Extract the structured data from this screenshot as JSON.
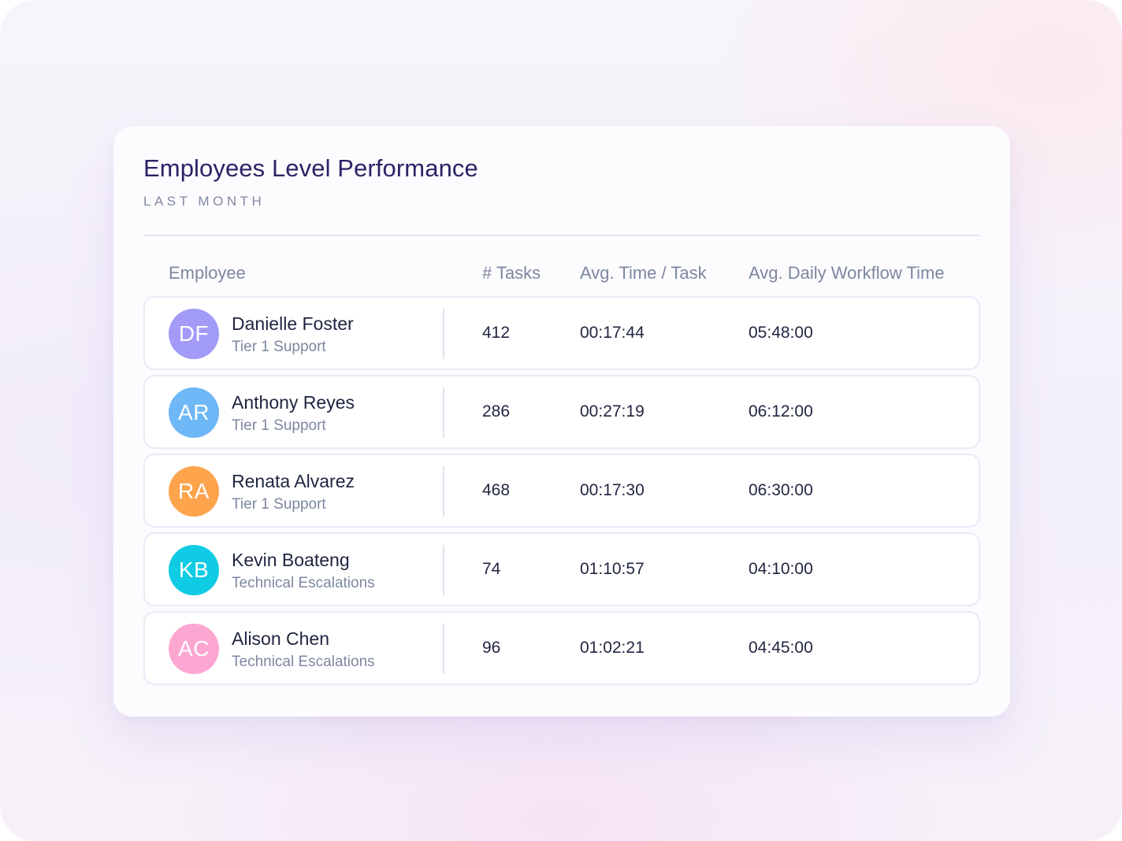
{
  "card": {
    "title": "Employees Level Performance",
    "subtitle": "LAST MONTH"
  },
  "table": {
    "columns": [
      "Employee",
      "# Tasks",
      "Avg. Time / Task",
      "Avg. Daily Workflow Time"
    ],
    "rows": [
      {
        "initials": "DF",
        "name": "Danielle Foster",
        "team": "Tier 1 Support",
        "tasks": "412",
        "avg_time": "00:17:44",
        "daily_time": "05:48:00",
        "avatar_color": "#a29bf8"
      },
      {
        "initials": "AR",
        "name": "Anthony Reyes",
        "team": "Tier 1 Support",
        "tasks": "286",
        "avg_time": "00:27:19",
        "daily_time": "06:12:00",
        "avatar_color": "#6fb8f7"
      },
      {
        "initials": "RA",
        "name": "Renata Alvarez",
        "team": "Tier 1 Support",
        "tasks": "468",
        "avg_time": "00:17:30",
        "daily_time": "06:30:00",
        "avatar_color": "#fda44c"
      },
      {
        "initials": "KB",
        "name": "Kevin Boateng",
        "team": "Technical Escalations",
        "tasks": "74",
        "avg_time": "01:10:57",
        "daily_time": "04:10:00",
        "avatar_color": "#0fcbe3"
      },
      {
        "initials": "AC",
        "name": "Alison Chen",
        "team": "Technical Escalations",
        "tasks": "96",
        "avg_time": "01:02:21",
        "daily_time": "04:45:00",
        "avatar_color": "#fca7d2"
      }
    ]
  },
  "colors": {
    "title": "#2a2466",
    "muted": "#7c87a0",
    "text": "#1f2540",
    "row_border": "#ece9f6"
  }
}
